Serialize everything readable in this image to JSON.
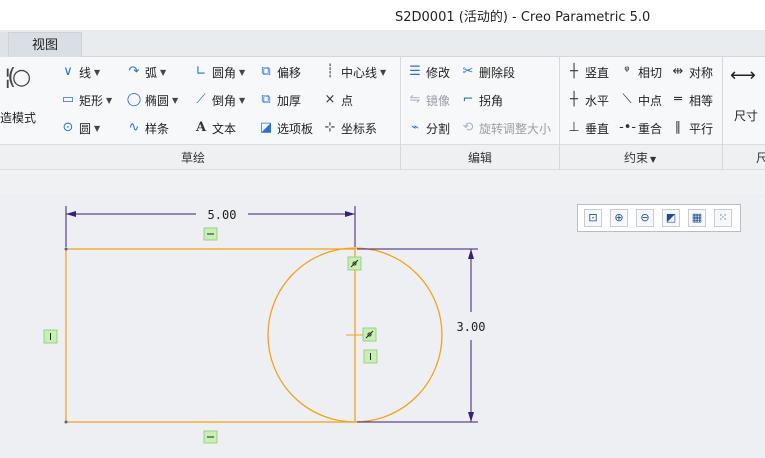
{
  "window": {
    "title": "S2D0001 (活动的) - Creo Parametric 5.0"
  },
  "tabs": [
    {
      "label": "视图"
    }
  ],
  "ribbon": {
    "construction_mode": "构造模式",
    "sketch": {
      "group_label": "草绘",
      "line": "线",
      "arc": "弧",
      "fillet": "圆角",
      "offset": "偏移",
      "centerline": "中心线",
      "rectangle": "矩形",
      "ellipse": "椭圆",
      "chamfer": "倒角",
      "thicken": "加厚",
      "point": "点",
      "circle": "圆",
      "spline": "样条",
      "text": "文本",
      "palette": "选项板",
      "coord_system": "坐标系"
    },
    "edit": {
      "group_label": "编辑",
      "modify": "修改",
      "delete_segment": "删除段",
      "mirror": "镜像",
      "corner": "拐角",
      "divide": "分割",
      "rotate_resize": "旋转调整大小"
    },
    "constrain": {
      "group_label": "约束",
      "vertical": "竖直",
      "tangent": "相切",
      "symmetric": "对称",
      "horizontal": "水平",
      "midpoint": "中点",
      "equal": "相等",
      "perpendicular": "垂直",
      "coincident": "重合",
      "parallel": "平行"
    },
    "dimension": {
      "group_label": "尺",
      "dimension": "尺寸"
    }
  },
  "sketch": {
    "dim_width": "5.00",
    "dim_height": "3.00",
    "colors": {
      "geometry": "#f5a21b",
      "dimension": "#3a1f7a",
      "constraint_bg": "#c9f0b3"
    }
  }
}
